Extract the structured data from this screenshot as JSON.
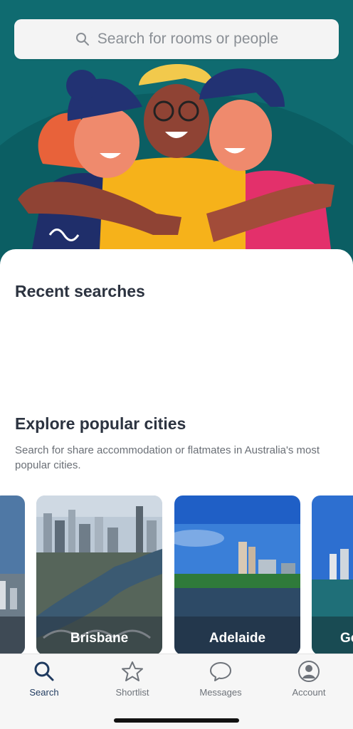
{
  "search": {
    "placeholder": "Search for rooms or people",
    "icon": "search-icon"
  },
  "recent": {
    "heading": "Recent searches"
  },
  "explore": {
    "heading": "Explore popular cities",
    "description": "Search for share accommodation or flatmates in Australia's most popular cities."
  },
  "cities": [
    {
      "name": ""
    },
    {
      "name": "Brisbane"
    },
    {
      "name": "Adelaide"
    },
    {
      "name": "Go"
    }
  ],
  "tabs": [
    {
      "label": "Search",
      "icon": "search-icon",
      "active": true
    },
    {
      "label": "Shortlist",
      "icon": "star-icon"
    },
    {
      "label": "Messages",
      "icon": "chat-bubble-icon"
    },
    {
      "label": "Account",
      "icon": "user-icon"
    }
  ],
  "colors": {
    "hero_bg": "#0f6b70",
    "heading": "#2c3340",
    "active_tab": "#1f3a5f"
  }
}
